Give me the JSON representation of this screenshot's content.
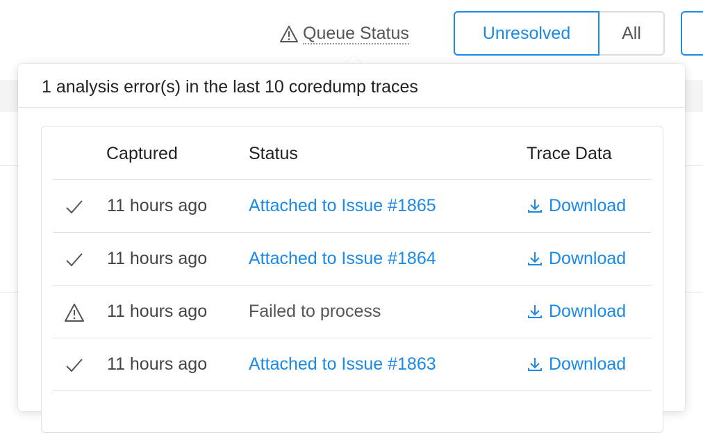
{
  "header": {
    "queue_status_label": "Queue Status",
    "segment": {
      "active_label": "Unresolved",
      "inactive_label": "All"
    }
  },
  "popover": {
    "title": "1 analysis error(s) in the last 10 coredump traces",
    "columns": [
      "Captured",
      "Status",
      "Trace Data"
    ],
    "rows": [
      {
        "state_icon": "check-icon",
        "captured": "11 hours ago",
        "status": "Attached to Issue #1865",
        "status_is_link": true,
        "download_label": "Download"
      },
      {
        "state_icon": "check-icon",
        "captured": "11 hours ago",
        "status": "Attached to Issue #1864",
        "status_is_link": true,
        "download_label": "Download"
      },
      {
        "state_icon": "warning-icon",
        "captured": "11 hours ago",
        "status": "Failed to process",
        "status_is_link": false,
        "download_label": "Download"
      },
      {
        "state_icon": "check-icon",
        "captured": "11 hours ago",
        "status": "Attached to Issue #1863",
        "status_is_link": true,
        "download_label": "Download"
      }
    ]
  },
  "colors": {
    "accent": "#1a8ae6",
    "border": "#e3e3e3",
    "text": "#444444"
  }
}
